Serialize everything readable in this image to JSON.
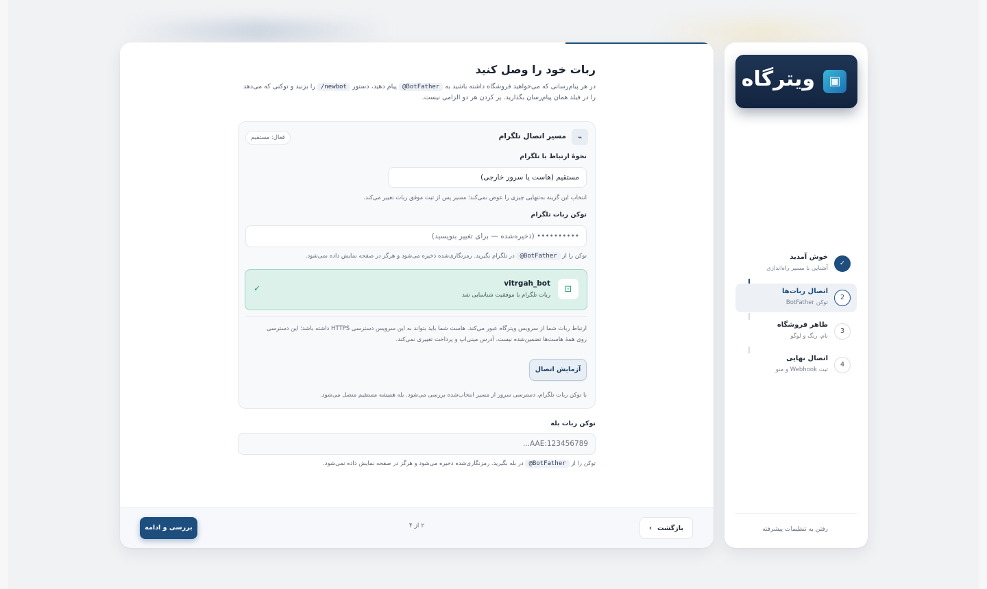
{
  "brand": {
    "logo_text": "ویترگاه",
    "logo_icon": "storefront-icon"
  },
  "page": {
    "title": "ربات خود را وصل کنید",
    "intro_part1": "در هر پیام‌رسانی که می‌خواهید فروشگاه داشته باشید به",
    "intro_code1": "@BotFather",
    "intro_part2": "پیام دهید، دستور",
    "intro_code2": "/newbot",
    "intro_part3": "را بزنید و توکنی که می‌دهد را در فیلد همان پیام‌رسان بگذارید. پر کردن هر دو الزامی نیست."
  },
  "telegram_route": {
    "title": "مسیر اتصال تلگرام",
    "badge": "فعال: مستقیم",
    "connection_label": "نحوهٔ ارتباط با تلگرام",
    "connection_value": "مستقیم (هاست یا سرور خارجی)",
    "connection_hint": "انتخاب این گزینه به‌تنهایی چیزی را عوض نمی‌کند؛ مسیر پس از ثبت موفق ربات تغییر می‌کند.",
    "token_label": "توکن ربات تلگرام",
    "token_placeholder": "•••••••••• (ذخیره‌شده — برای تغییر بنویسید)",
    "token_hint_part1": "توکن را از",
    "token_hint_code": "@BotFather",
    "token_hint_part2": "در تلگرام بگیرید. رمزنگاری‌شده ذخیره می‌شود و هرگز در صفحه نمایش داده نمی‌شود.",
    "bot_username": "vitrgah_bot",
    "bot_status": "ربات تلگرام با موفقیت شناسایی شد",
    "note": "ارتباط ربات شما از سرویس ویترگاه عبور می‌کند. هاست شما باید بتواند به این سرویس دسترسی HTTPS داشته باشد؛ این دسترسی روی همهٔ هاست‌ها تضمین‌شده نیست. آدرس مینی‌اپ و پرداخت تغییری نمی‌کند.",
    "test_button": "آزمایش اتصال",
    "footer_note": "با توکن ربات تلگرام، دسترسی سرور از مسیر انتخاب‌شده بررسی می‌شود. بله همیشه مستقیم متصل می‌شود."
  },
  "bale": {
    "token_label": "توکن ربات بله",
    "token_placeholder": "123456789:AAE...",
    "hint_part1": "توکن را از",
    "hint_code": "@BotFather",
    "hint_part2": "در بله بگیرید. رمزنگاری‌شده ذخیره می‌شود و هرگز در صفحه نمایش داده نمی‌شود."
  },
  "footer": {
    "back_label": "بازگشت",
    "step_count": "۲ از ۴",
    "continue_label": "بررسی و ادامه"
  },
  "steps": [
    {
      "number": "✓",
      "title": "خوش آمدید",
      "subtitle": "آشنایی با مسیر راه‌اندازی",
      "state": "done"
    },
    {
      "number": "2",
      "title": "اتصال ربات‌ها",
      "subtitle": "توکن BotFather",
      "state": "current"
    },
    {
      "number": "3",
      "title": "ظاهر فروشگاه",
      "subtitle": "نام، رنگ و لوگو",
      "state": "pending"
    },
    {
      "number": "4",
      "title": "اتصال نهایی",
      "subtitle": "ثبت Webhook و منو",
      "state": "pending"
    }
  ],
  "sidebar": {
    "advanced_link": "رفتن به تنظیمات پیشرفته"
  },
  "colors": {
    "primary": "#1d4e7e",
    "success_bg": "#dbf1ea",
    "success": "#1f9a73"
  }
}
